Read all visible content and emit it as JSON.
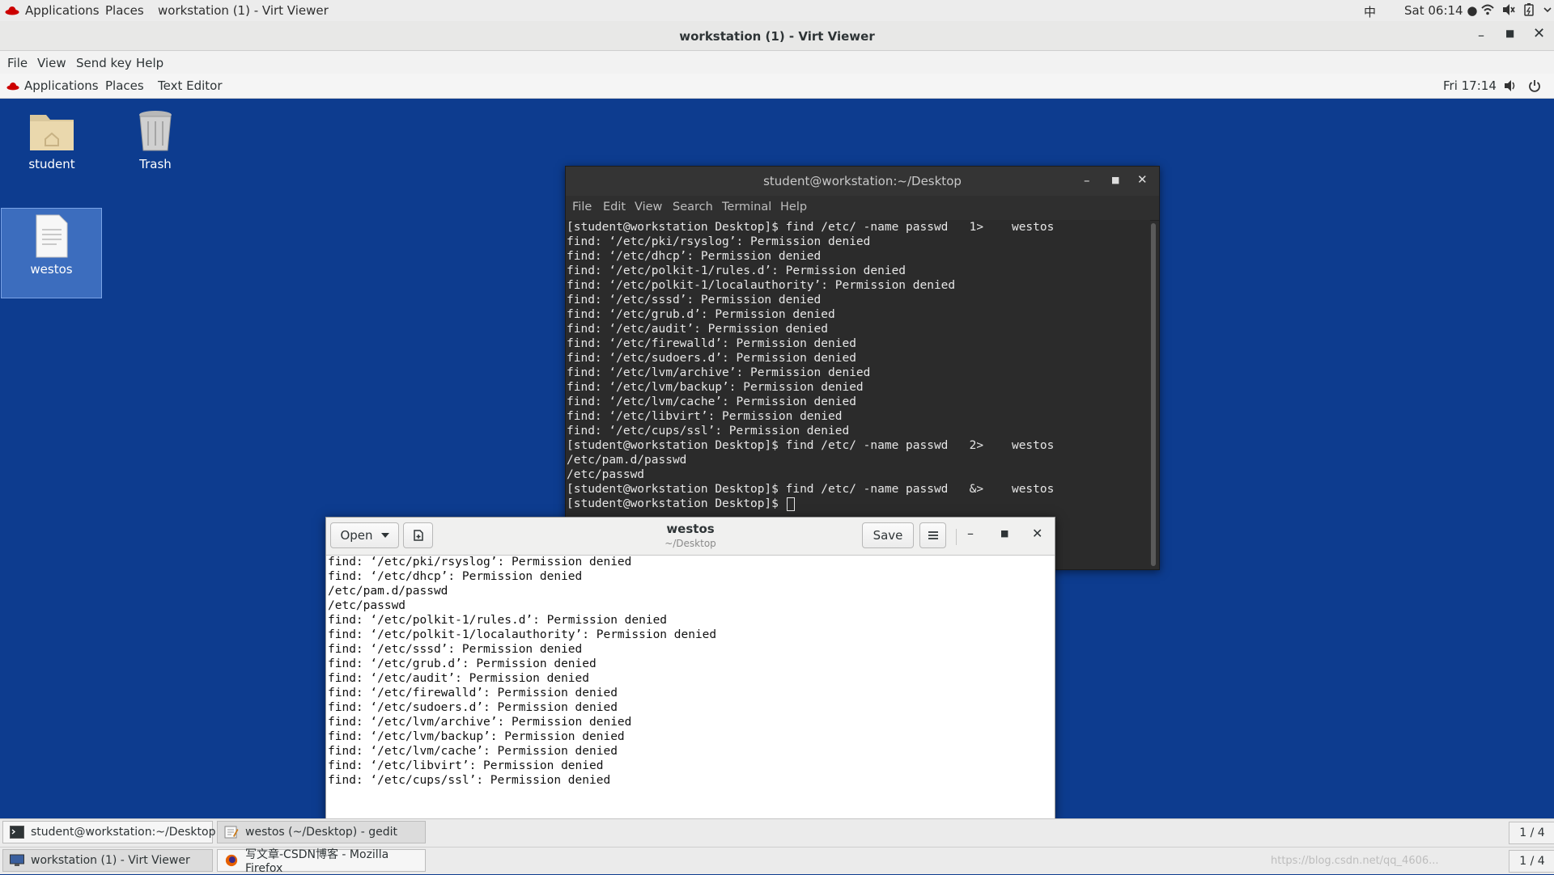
{
  "host_bar": {
    "applications": "Applications",
    "places": "Places",
    "window_label": "workstation (1) - Virt Viewer",
    "input_method": "中",
    "clock": "Sat 06:14 ●"
  },
  "virt_viewer": {
    "title": "workstation (1) - Virt Viewer",
    "menu": {
      "file": "File",
      "view": "View",
      "send_key": "Send key",
      "help": "Help"
    }
  },
  "guest_panel": {
    "applications": "Applications",
    "places": "Places",
    "active_app": "Text Editor",
    "clock": "Fri 17:14"
  },
  "desktop": {
    "icons": {
      "home": "student",
      "trash": "Trash",
      "file": "westos"
    }
  },
  "terminal": {
    "title": "student@workstation:~/Desktop",
    "menu": {
      "file": "File",
      "edit": "Edit",
      "view": "View",
      "search": "Search",
      "terminal": "Terminal",
      "help": "Help"
    },
    "lines": [
      "[student@workstation Desktop]$ find /etc/ -name passwd   1>    westos",
      "find: ‘/etc/pki/rsyslog’: Permission denied",
      "find: ‘/etc/dhcp’: Permission denied",
      "find: ‘/etc/polkit-1/rules.d’: Permission denied",
      "find: ‘/etc/polkit-1/localauthority’: Permission denied",
      "find: ‘/etc/sssd’: Permission denied",
      "find: ‘/etc/grub.d’: Permission denied",
      "find: ‘/etc/audit’: Permission denied",
      "find: ‘/etc/firewalld’: Permission denied",
      "find: ‘/etc/sudoers.d’: Permission denied",
      "find: ‘/etc/lvm/archive’: Permission denied",
      "find: ‘/etc/lvm/backup’: Permission denied",
      "find: ‘/etc/lvm/cache’: Permission denied",
      "find: ‘/etc/libvirt’: Permission denied",
      "find: ‘/etc/cups/ssl’: Permission denied",
      "[student@workstation Desktop]$ find /etc/ -name passwd   2>    westos",
      "/etc/pam.d/passwd",
      "/etc/passwd",
      "[student@workstation Desktop]$ find /etc/ -name passwd   &>    westos",
      "[student@workstation Desktop]$ "
    ]
  },
  "gedit": {
    "open_label": "Open",
    "title": "westos",
    "subtitle": "~/Desktop",
    "save_label": "Save",
    "lines": [
      "find: ‘/etc/pki/rsyslog’: Permission denied",
      "find: ‘/etc/dhcp’: Permission denied",
      "/etc/pam.d/passwd",
      "/etc/passwd",
      "find: ‘/etc/polkit-1/rules.d’: Permission denied",
      "find: ‘/etc/polkit-1/localauthority’: Permission denied",
      "find: ‘/etc/sssd’: Permission denied",
      "find: ‘/etc/grub.d’: Permission denied",
      "find: ‘/etc/audit’: Permission denied",
      "find: ‘/etc/firewalld’: Permission denied",
      "find: ‘/etc/sudoers.d’: Permission denied",
      "find: ‘/etc/lvm/archive’: Permission denied",
      "find: ‘/etc/lvm/backup’: Permission denied",
      "find: ‘/etc/lvm/cache’: Permission denied",
      "find: ‘/etc/libvirt’: Permission denied",
      "find: ‘/etc/cups/ssl’: Permission denied"
    ]
  },
  "guest_taskbar": {
    "tasks": [
      "student@workstation:~/Desktop",
      "westos (~/Desktop) - gedit"
    ],
    "workspace": "1 / 4"
  },
  "host_taskbar": {
    "tasks": [
      "workstation (1) - Virt Viewer",
      "写文章-CSDN博客 - Mozilla Firefox"
    ],
    "workspace": "1 / 4",
    "watermark": "https://blog.csdn.net/qq_4606..."
  },
  "colors": {
    "desktop_bg": "#0d3c8f",
    "terminal_bg": "#2b2b2b",
    "redhat_red": "#cc0000"
  }
}
